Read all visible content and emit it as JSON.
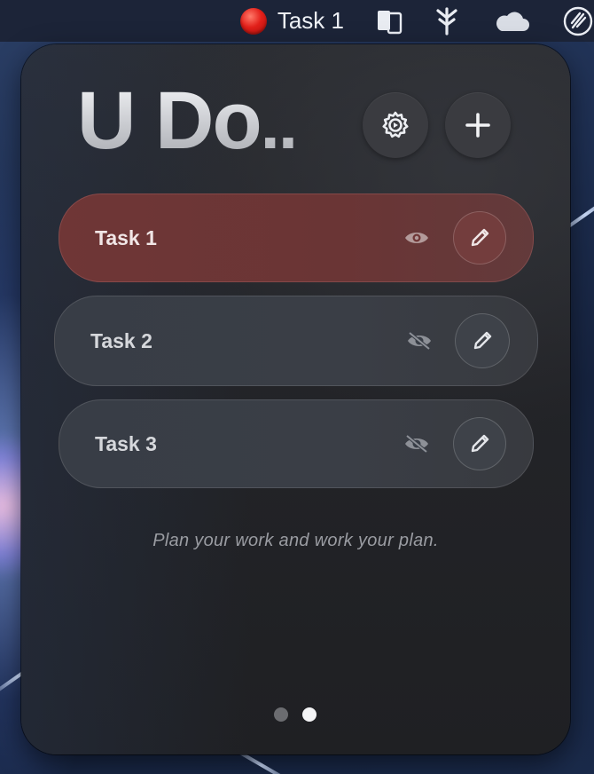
{
  "menubar": {
    "status_icon": "red-circle-icon",
    "task_title": "Task 1",
    "items": [
      "document-icon",
      "fork-icon",
      "cloud-icon",
      "rocket-icon"
    ]
  },
  "app": {
    "title_main": "U Do",
    "title_dots": "..",
    "settings_icon": "gear-icon",
    "add_icon": "plus-icon"
  },
  "tasks": [
    {
      "label": "Task 1",
      "visible": true,
      "active": true,
      "eye_icon": "eye-icon",
      "edit_icon": "pencil-icon"
    },
    {
      "label": "Task 2",
      "visible": false,
      "active": false,
      "eye_icon": "eye-slash-icon",
      "edit_icon": "pencil-icon"
    },
    {
      "label": "Task 3",
      "visible": false,
      "active": false,
      "eye_icon": "eye-slash-icon",
      "edit_icon": "pencil-icon"
    }
  ],
  "footer": {
    "quote": "Plan your work and work your plan.",
    "pages": 2,
    "current_page": 2
  },
  "colors": {
    "active_task": "#6f3636",
    "inactive_task": "#383d46",
    "panel_bg": "#232428",
    "status_red": "#e3201a"
  }
}
